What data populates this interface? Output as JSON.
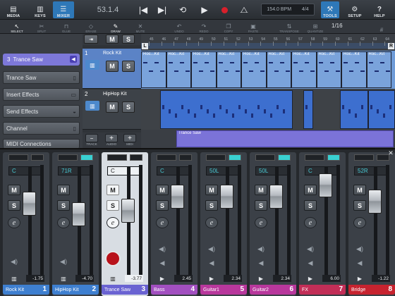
{
  "toolbar": {
    "media": "MEDIA",
    "keys": "KEYS",
    "mixer": "MIXER",
    "position": "53.1.4",
    "tempo": "154.0 BPM",
    "signature": "4/4",
    "tools": "TOOLS",
    "setup": "SETUP",
    "help": "HELP"
  },
  "edit_tools": {
    "select": "SELECT",
    "split": "SPLIT",
    "glue": "GLUE",
    "erase": "ERASE",
    "draw": "DRAW",
    "mute": "MUTE",
    "undo": "UNDO",
    "redo": "REDO",
    "copy": "COPY",
    "paste": "PASTE",
    "transpose": "TRANSPOSE",
    "quantize": "QUANTIZE",
    "quantize_value": "1/16"
  },
  "inspector": {
    "header_number": "3",
    "header_name": "Trance Saw",
    "items": [
      "Trance Saw",
      "Insert Effects",
      "Send Effects",
      "Channel",
      "MIDI Connections"
    ]
  },
  "tracks": [
    {
      "number": "1",
      "name": "Rock Kit",
      "mute": "M",
      "solo": "S"
    },
    {
      "number": "2",
      "name": "HipHop Kit",
      "mute": "M",
      "solo": "S"
    }
  ],
  "track_header_tools": {
    "track": "TRACK",
    "audio": "AUDIO",
    "midi": "MIDI",
    "mute": "M",
    "solo": "S"
  },
  "ruler": {
    "ticks": [
      "45",
      "46",
      "47",
      "48",
      "49",
      "50",
      "51",
      "52",
      "53",
      "54",
      "55",
      "56",
      "57",
      "58",
      "59",
      "60",
      "61",
      "62",
      "63",
      "64",
      "65"
    ],
    "left_marker": "L",
    "right_marker": "R"
  },
  "clips": {
    "rock_kit_label": "Roc...Kit",
    "trance_saw_label": "Trance Saw"
  },
  "mixer": {
    "channels": [
      {
        "name": "Rock Kit",
        "number": "1",
        "pan": "C",
        "volume": "-1.75",
        "color": "#3e7fd0",
        "level": 0.72,
        "led": false,
        "mute": "M",
        "solo": "S",
        "edit": "e"
      },
      {
        "name": "HipHop Kit",
        "number": "2",
        "pan": "71R",
        "volume": "-4.70",
        "color": "#3e7fd0",
        "level": 0.6,
        "led": true,
        "mute": "M",
        "solo": "S",
        "edit": "e"
      },
      {
        "name": "Trance Saw",
        "number": "3",
        "pan": "C",
        "volume": "-3.77",
        "color": "#6a63d2",
        "level": 0.64,
        "led": false,
        "mute": "M",
        "solo": "S",
        "edit": "e",
        "selected": true
      },
      {
        "name": "Bass",
        "number": "4",
        "pan": "C",
        "volume": "2.45",
        "color": "#a24fc0",
        "level": 0.8,
        "led": false,
        "mute": "M",
        "solo": "S",
        "edit": "e"
      },
      {
        "name": "Guitar1",
        "number": "5",
        "pan": "50L",
        "volume": "2.34",
        "color": "#b8379c",
        "level": 0.8,
        "led": true,
        "mute": "M",
        "solo": "S",
        "edit": "e"
      },
      {
        "name": "Guitar2",
        "number": "6",
        "pan": "50L",
        "volume": "2.34",
        "color": "#b8379c",
        "level": 0.8,
        "led": true,
        "mute": "M",
        "solo": "S",
        "edit": "e"
      },
      {
        "name": "FX",
        "number": "7",
        "pan": "C",
        "volume": "6.00",
        "color": "#c22e57",
        "level": 0.92,
        "led": true,
        "mute": "M",
        "solo": "S",
        "edit": "e"
      },
      {
        "name": "Bridge",
        "number": "8",
        "pan": "52R",
        "volume": "-1.22",
        "color": "#c7232f",
        "level": 0.74,
        "led": false,
        "mute": "M",
        "solo": "S",
        "edit": "e"
      }
    ]
  },
  "colors": {
    "accent": "#2e78b8",
    "track_blue": "#3e7fd0",
    "track_purple": "#6a63d2",
    "record": "#b8121b",
    "led_cyan": "#39d0d2"
  }
}
